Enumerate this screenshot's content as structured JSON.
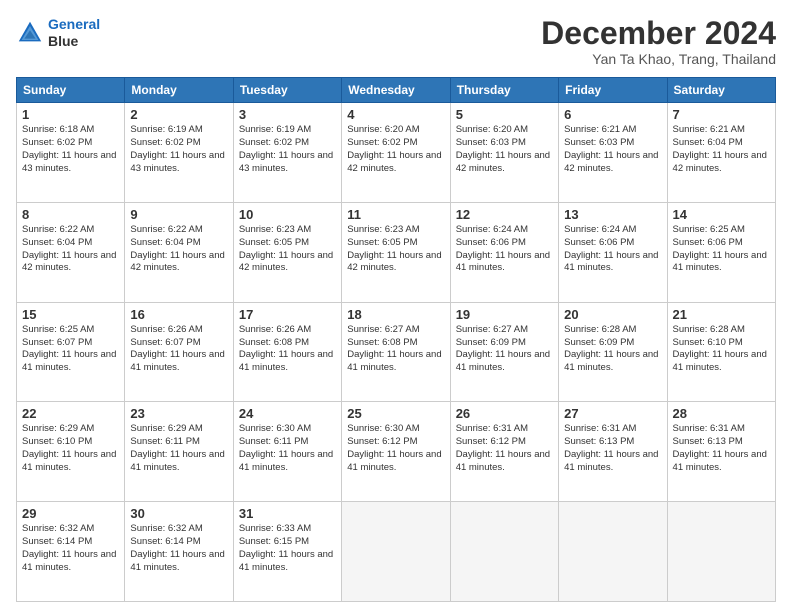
{
  "logo": {
    "line1": "General",
    "line2": "Blue"
  },
  "title": "December 2024",
  "subtitle": "Yan Ta Khao, Trang, Thailand",
  "weekdays": [
    "Sunday",
    "Monday",
    "Tuesday",
    "Wednesday",
    "Thursday",
    "Friday",
    "Saturday"
  ],
  "weeks": [
    [
      {
        "day": 1,
        "sunrise": "6:18 AM",
        "sunset": "6:02 PM",
        "daylight": "11 hours and 43 minutes."
      },
      {
        "day": 2,
        "sunrise": "6:19 AM",
        "sunset": "6:02 PM",
        "daylight": "11 hours and 43 minutes."
      },
      {
        "day": 3,
        "sunrise": "6:19 AM",
        "sunset": "6:02 PM",
        "daylight": "11 hours and 43 minutes."
      },
      {
        "day": 4,
        "sunrise": "6:20 AM",
        "sunset": "6:02 PM",
        "daylight": "11 hours and 42 minutes."
      },
      {
        "day": 5,
        "sunrise": "6:20 AM",
        "sunset": "6:03 PM",
        "daylight": "11 hours and 42 minutes."
      },
      {
        "day": 6,
        "sunrise": "6:21 AM",
        "sunset": "6:03 PM",
        "daylight": "11 hours and 42 minutes."
      },
      {
        "day": 7,
        "sunrise": "6:21 AM",
        "sunset": "6:04 PM",
        "daylight": "11 hours and 42 minutes."
      }
    ],
    [
      {
        "day": 8,
        "sunrise": "6:22 AM",
        "sunset": "6:04 PM",
        "daylight": "11 hours and 42 minutes."
      },
      {
        "day": 9,
        "sunrise": "6:22 AM",
        "sunset": "6:04 PM",
        "daylight": "11 hours and 42 minutes."
      },
      {
        "day": 10,
        "sunrise": "6:23 AM",
        "sunset": "6:05 PM",
        "daylight": "11 hours and 42 minutes."
      },
      {
        "day": 11,
        "sunrise": "6:23 AM",
        "sunset": "6:05 PM",
        "daylight": "11 hours and 42 minutes."
      },
      {
        "day": 12,
        "sunrise": "6:24 AM",
        "sunset": "6:06 PM",
        "daylight": "11 hours and 41 minutes."
      },
      {
        "day": 13,
        "sunrise": "6:24 AM",
        "sunset": "6:06 PM",
        "daylight": "11 hours and 41 minutes."
      },
      {
        "day": 14,
        "sunrise": "6:25 AM",
        "sunset": "6:06 PM",
        "daylight": "11 hours and 41 minutes."
      }
    ],
    [
      {
        "day": 15,
        "sunrise": "6:25 AM",
        "sunset": "6:07 PM",
        "daylight": "11 hours and 41 minutes."
      },
      {
        "day": 16,
        "sunrise": "6:26 AM",
        "sunset": "6:07 PM",
        "daylight": "11 hours and 41 minutes."
      },
      {
        "day": 17,
        "sunrise": "6:26 AM",
        "sunset": "6:08 PM",
        "daylight": "11 hours and 41 minutes."
      },
      {
        "day": 18,
        "sunrise": "6:27 AM",
        "sunset": "6:08 PM",
        "daylight": "11 hours and 41 minutes."
      },
      {
        "day": 19,
        "sunrise": "6:27 AM",
        "sunset": "6:09 PM",
        "daylight": "11 hours and 41 minutes."
      },
      {
        "day": 20,
        "sunrise": "6:28 AM",
        "sunset": "6:09 PM",
        "daylight": "11 hours and 41 minutes."
      },
      {
        "day": 21,
        "sunrise": "6:28 AM",
        "sunset": "6:10 PM",
        "daylight": "11 hours and 41 minutes."
      }
    ],
    [
      {
        "day": 22,
        "sunrise": "6:29 AM",
        "sunset": "6:10 PM",
        "daylight": "11 hours and 41 minutes."
      },
      {
        "day": 23,
        "sunrise": "6:29 AM",
        "sunset": "6:11 PM",
        "daylight": "11 hours and 41 minutes."
      },
      {
        "day": 24,
        "sunrise": "6:30 AM",
        "sunset": "6:11 PM",
        "daylight": "11 hours and 41 minutes."
      },
      {
        "day": 25,
        "sunrise": "6:30 AM",
        "sunset": "6:12 PM",
        "daylight": "11 hours and 41 minutes."
      },
      {
        "day": 26,
        "sunrise": "6:31 AM",
        "sunset": "6:12 PM",
        "daylight": "11 hours and 41 minutes."
      },
      {
        "day": 27,
        "sunrise": "6:31 AM",
        "sunset": "6:13 PM",
        "daylight": "11 hours and 41 minutes."
      },
      {
        "day": 28,
        "sunrise": "6:31 AM",
        "sunset": "6:13 PM",
        "daylight": "11 hours and 41 minutes."
      }
    ],
    [
      {
        "day": 29,
        "sunrise": "6:32 AM",
        "sunset": "6:14 PM",
        "daylight": "11 hours and 41 minutes."
      },
      {
        "day": 30,
        "sunrise": "6:32 AM",
        "sunset": "6:14 PM",
        "daylight": "11 hours and 41 minutes."
      },
      {
        "day": 31,
        "sunrise": "6:33 AM",
        "sunset": "6:15 PM",
        "daylight": "11 hours and 41 minutes."
      },
      null,
      null,
      null,
      null
    ]
  ]
}
